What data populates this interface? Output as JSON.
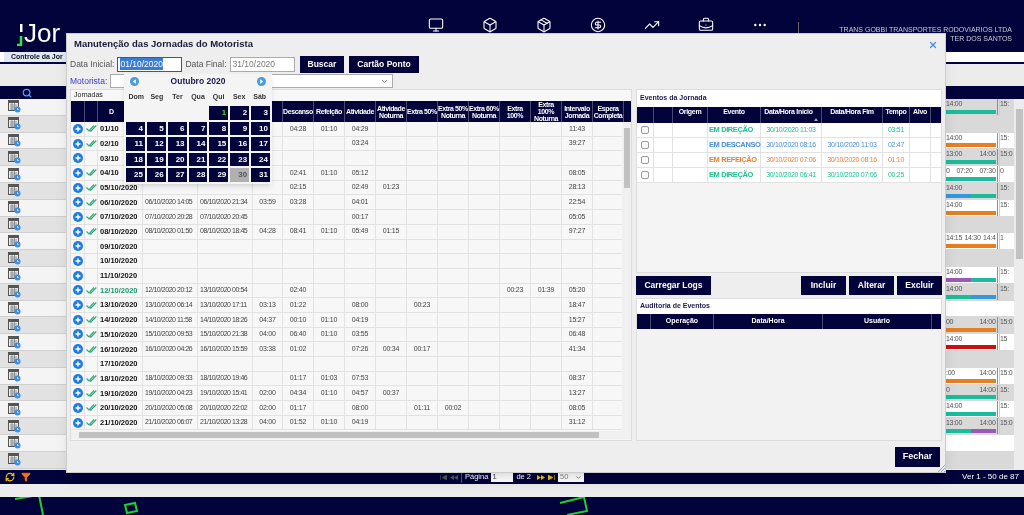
{
  "header": {
    "logo": "Jor",
    "company": "TRANS GOBBI TRANSPORTES RODOVIARIOS LTDA",
    "user": "TER DOS SANTOS"
  },
  "page_tab": "Controle da Jor",
  "grid": {
    "rows": [
      {
        "shaded": true,
        "labels": [
          "14:00",
          "15:"
        ],
        "segments": [
          {
            "color": "#1abc9c"
          }
        ]
      },
      {
        "shaded": true
      },
      {
        "shaded": false,
        "labels": [
          "14:00",
          "15:"
        ],
        "segments": [
          {
            "color": "#e67e22"
          }
        ]
      },
      {
        "shaded": true,
        "labels": [
          "13:00",
          "14:00",
          "15:0"
        ],
        "segments": [
          {
            "color": "#1abc9c"
          }
        ]
      },
      {
        "shaded": false,
        "labels": [
          "0",
          "07:20",
          "07:30",
          "0"
        ],
        "segments": [
          {
            "color": "#1abc9c"
          }
        ]
      },
      {
        "shaded": true,
        "labels": [
          "14:00",
          "15:"
        ],
        "segments": [
          {
            "color": "#3498db"
          },
          {
            "color": "#1abc9c"
          }
        ]
      },
      {
        "shaded": false,
        "labels": [
          "14:00",
          "15:"
        ],
        "segments": [
          {
            "color": "#e67e22"
          }
        ]
      },
      {
        "shaded": true
      },
      {
        "shaded": false,
        "labels": [
          "14:15",
          "14:30",
          "14:4",
          "1"
        ],
        "segments": [
          {
            "color": "#e67e22"
          }
        ]
      },
      {
        "shaded": true
      },
      {
        "shaded": false,
        "labels": [
          "14:00",
          "15:"
        ],
        "segments": [
          {
            "color": "#9b59b6"
          },
          {
            "color": "#1abc9c"
          }
        ]
      },
      {
        "shaded": true,
        "labels": [
          "14:00",
          "15:"
        ],
        "segments": [
          {
            "color": "#1abc9c"
          },
          {
            "color": "#3498db"
          }
        ]
      },
      {
        "shaded": false
      },
      {
        "shaded": true,
        "labels": [
          "00",
          "14:00",
          "15:0"
        ],
        "segments": [
          {
            "color": "#e67e22"
          }
        ]
      },
      {
        "shaded": false,
        "labels": [
          "14:00",
          "15"
        ],
        "segments": [
          {
            "color": "#cc1010"
          }
        ]
      },
      {
        "shaded": true
      },
      {
        "shaded": false,
        "labels": [
          ":00",
          "14:00",
          "15:0"
        ],
        "segments": [
          {
            "color": "#e67e22"
          }
        ]
      },
      {
        "shaded": true,
        "labels": [
          "0",
          "14:00",
          "15:"
        ],
        "segments": [
          {
            "color": "#1abc9c"
          }
        ]
      },
      {
        "shaded": false,
        "labels": [
          "14:00",
          "15:"
        ],
        "segments": [
          {
            "color": "#1abc9c"
          }
        ]
      },
      {
        "shaded": true,
        "labels": [
          "13:00",
          "14:00",
          "15:0"
        ],
        "segments": [
          {
            "color": "#1abc9c"
          },
          {
            "color": "#9b59b6"
          }
        ]
      },
      {
        "shaded": false
      },
      {
        "shaded": true
      }
    ]
  },
  "pager": {
    "page_label": "Página",
    "page": "1",
    "page_total": "de 2",
    "page_size": "50",
    "summary": "Ver 1 - 50 de 87"
  },
  "modal": {
    "title": "Manutenção das Jornadas do Motorista",
    "filters": {
      "start_label": "Data Inicial:",
      "start_value": "01/10/2020",
      "end_label": "Data Final:",
      "end_value": "31/10/2020",
      "driver_label": "Motorista:"
    },
    "buttons": [
      "Buscar",
      "Cartão Ponto"
    ],
    "calendar": {
      "month": "Outubro 2020",
      "weekdays": [
        "Dom",
        "Seg",
        "Ter",
        "Qua",
        "Qui",
        "Sex",
        "Sáb"
      ],
      "weeks": [
        [
          {
            "kind": "blank"
          },
          {
            "kind": "blank"
          },
          {
            "kind": "blank"
          },
          {
            "kind": "blank"
          },
          {
            "kind": "day",
            "label": "1",
            "selected": true,
            "today": false
          },
          {
            "kind": "day",
            "label": "2",
            "selected": false,
            "today": false
          },
          {
            "kind": "day",
            "label": "3",
            "selected": false,
            "today": false
          }
        ],
        [
          {
            "kind": "day",
            "label": "4",
            "selected": false,
            "today": false
          },
          {
            "kind": "day",
            "label": "5",
            "selected": false,
            "today": false
          },
          {
            "kind": "day",
            "label": "6",
            "selected": false,
            "today": false
          },
          {
            "kind": "day",
            "label": "7",
            "selected": false,
            "today": false
          },
          {
            "kind": "day",
            "label": "8",
            "selected": false,
            "today": false
          },
          {
            "kind": "day",
            "label": "9",
            "selected": false,
            "today": false
          },
          {
            "kind": "day",
            "label": "10",
            "selected": false,
            "today": false
          }
        ],
        [
          {
            "kind": "day",
            "label": "11",
            "selected": false,
            "today": false
          },
          {
            "kind": "day",
            "label": "12",
            "selected": false,
            "today": false
          },
          {
            "kind": "day",
            "label": "13",
            "selected": false,
            "today": false
          },
          {
            "kind": "day",
            "label": "14",
            "selected": false,
            "today": false
          },
          {
            "kind": "day",
            "label": "15",
            "selected": false,
            "today": false
          },
          {
            "kind": "day",
            "label": "16",
            "selected": false,
            "today": false
          },
          {
            "kind": "day",
            "label": "17",
            "selected": false,
            "today": false
          }
        ],
        [
          {
            "kind": "day",
            "label": "18",
            "selected": false,
            "today": false
          },
          {
            "kind": "day",
            "label": "19",
            "selected": false,
            "today": false
          },
          {
            "kind": "day",
            "label": "20",
            "selected": false,
            "today": false
          },
          {
            "kind": "day",
            "label": "21",
            "selected": false,
            "today": false
          },
          {
            "kind": "day",
            "label": "22",
            "selected": false,
            "today": false
          },
          {
            "kind": "day",
            "label": "23",
            "selected": false,
            "today": false
          },
          {
            "kind": "day",
            "label": "24",
            "selected": false,
            "today": false
          }
        ],
        [
          {
            "kind": "day",
            "label": "25",
            "selected": false,
            "today": false
          },
          {
            "kind": "day",
            "label": "26",
            "selected": false,
            "today": false
          },
          {
            "kind": "day",
            "label": "27",
            "selected": false,
            "today": false
          },
          {
            "kind": "day",
            "label": "28",
            "selected": false,
            "today": false
          },
          {
            "kind": "day",
            "label": "29",
            "selected": false,
            "today": false
          },
          {
            "kind": "day",
            "label": "30",
            "selected": false,
            "today": true
          },
          {
            "kind": "day",
            "label": "31",
            "selected": false,
            "today": false
          }
        ]
      ]
    },
    "jornadas": {
      "caption": "Jornadas",
      "columns": [
        {
          "kind": "date",
          "label": "D"
        },
        {
          "kind": "datetime"
        },
        {
          "kind": "datetime"
        },
        {
          "kind": "duration"
        },
        {
          "kind": "duration",
          "label": "Descanso"
        },
        {
          "kind": "duration",
          "label": "Refeição"
        },
        {
          "kind": "duration",
          "label": "Atividade"
        },
        {
          "kind": "duration",
          "label": "Atividade Noturna"
        },
        {
          "kind": "duration",
          "label": "Extra 50%"
        },
        {
          "kind": "duration",
          "label": "Extra 50% Noturna"
        },
        {
          "kind": "duration",
          "label": "Extra 60% Noturna"
        },
        {
          "kind": "duration",
          "label": "Extra 100%"
        },
        {
          "kind": "duration",
          "label": "Extra 100% Noturna"
        },
        {
          "kind": "duration",
          "label": "Intervalo Jornada"
        },
        {
          "kind": "duration",
          "label": "Espera Completa"
        }
      ],
      "rows": [
        {
          "validated": true,
          "highlighted": false,
          "cells": [
            "01/10",
            null,
            null,
            null,
            "04:28",
            "01:10",
            "04:29",
            null,
            null,
            null,
            null,
            null,
            null,
            "11:43",
            null
          ]
        },
        {
          "validated": true,
          "highlighted": false,
          "cells": [
            "02/10",
            null,
            null,
            null,
            null,
            null,
            "03:24",
            null,
            null,
            null,
            null,
            null,
            null,
            "39:27",
            null
          ]
        },
        {
          "validated": false,
          "highlighted": false,
          "cells": [
            "03/10",
            null,
            null,
            null,
            null,
            null,
            null,
            null,
            null,
            null,
            null,
            null,
            null,
            null,
            null
          ]
        },
        {
          "validated": true,
          "highlighted": false,
          "cells": [
            "04/10",
            null,
            null,
            null,
            "02:41",
            "01:10",
            "05:12",
            null,
            null,
            null,
            null,
            null,
            null,
            "08:05",
            null
          ]
        },
        {
          "validated": true,
          "highlighted": false,
          "cells": [
            "05/10/2020",
            null,
            null,
            null,
            "02:15",
            null,
            "02:49",
            "01:23",
            null,
            null,
            null,
            null,
            null,
            "28:13",
            null
          ]
        },
        {
          "validated": true,
          "highlighted": false,
          "cells": [
            "06/10/2020",
            "06/10/2020 14:05",
            "06/10/2020 21:34",
            "03:59",
            "03:28",
            null,
            "04:01",
            null,
            null,
            null,
            null,
            null,
            null,
            "22:54",
            null
          ]
        },
        {
          "validated": true,
          "highlighted": false,
          "cells": [
            "07/10/2020",
            "07/10/2020 20:28",
            "07/10/2020 20:45",
            null,
            null,
            null,
            "00:17",
            null,
            null,
            null,
            null,
            null,
            null,
            "05:05",
            null
          ]
        },
        {
          "validated": true,
          "highlighted": false,
          "cells": [
            "08/10/2020",
            "08/10/2020 01:50",
            "08/10/2020 18:45",
            "04:28",
            "08:41",
            "01:10",
            "05:49",
            "01:15",
            null,
            null,
            null,
            null,
            null,
            "97:27",
            null
          ]
        },
        {
          "validated": false,
          "highlighted": false,
          "cells": [
            "09/10/2020",
            null,
            null,
            null,
            null,
            null,
            null,
            null,
            null,
            null,
            null,
            null,
            null,
            null,
            null
          ]
        },
        {
          "validated": false,
          "highlighted": false,
          "cells": [
            "10/10/2020",
            null,
            null,
            null,
            null,
            null,
            null,
            null,
            null,
            null,
            null,
            null,
            null,
            null,
            null
          ]
        },
        {
          "validated": false,
          "highlighted": false,
          "cells": [
            "11/10/2020",
            null,
            null,
            null,
            null,
            null,
            null,
            null,
            null,
            null,
            null,
            null,
            null,
            null,
            null
          ]
        },
        {
          "validated": true,
          "highlighted": true,
          "cells": [
            "12/10/2020",
            "12/10/2020 20:12",
            "13/10/2020 00:54",
            null,
            "02:40",
            null,
            null,
            null,
            null,
            null,
            null,
            "00:23",
            "01:39",
            "05:20",
            null
          ]
        },
        {
          "validated": true,
          "highlighted": false,
          "cells": [
            "13/10/2020",
            "13/10/2020 06:14",
            "13/10/2020 17:11",
            "03:13",
            "01:22",
            null,
            "08:00",
            null,
            "00:23",
            null,
            null,
            null,
            null,
            "18:47",
            null
          ]
        },
        {
          "validated": true,
          "highlighted": false,
          "cells": [
            "14/10/2020",
            "14/10/2020 11:58",
            "14/10/2020 18:26",
            "04:37",
            "00:10",
            "01:10",
            "04:19",
            null,
            null,
            null,
            null,
            null,
            null,
            "15:27",
            null
          ]
        },
        {
          "validated": true,
          "highlighted": false,
          "cells": [
            "15/10/2020",
            "15/10/2020 09:53",
            "15/10/2020 21:38",
            "04:00",
            "06:40",
            "01:10",
            "03:55",
            null,
            null,
            null,
            null,
            null,
            null,
            "06:48",
            null
          ]
        },
        {
          "validated": true,
          "highlighted": false,
          "cells": [
            "16/10/2020",
            "16/10/2020 04:26",
            "16/10/2020 15:59",
            "03:38",
            "01:02",
            null,
            "07:26",
            "00:34",
            "00:17",
            null,
            null,
            null,
            null,
            "41:34",
            null
          ]
        },
        {
          "validated": false,
          "highlighted": false,
          "cells": [
            "17/10/2020",
            null,
            null,
            null,
            null,
            null,
            null,
            null,
            null,
            null,
            null,
            null,
            null,
            null,
            null
          ]
        },
        {
          "validated": true,
          "highlighted": false,
          "cells": [
            "18/10/2020",
            "18/10/2020 09:33",
            "18/10/2020 19:46",
            null,
            "01:17",
            "01:03",
            "07:53",
            null,
            null,
            null,
            null,
            null,
            null,
            "08:37",
            null
          ]
        },
        {
          "validated": true,
          "highlighted": false,
          "cells": [
            "19/10/2020",
            "19/10/2020 04:23",
            "19/10/2020 15:41",
            "02:00",
            "04:34",
            "01:10",
            "04:57",
            "00:37",
            null,
            null,
            null,
            null,
            null,
            "13:27",
            null
          ]
        },
        {
          "validated": true,
          "highlighted": false,
          "cells": [
            "20/10/2020",
            "20/10/2020 05:08",
            "20/10/2020 22:02",
            "02:00",
            "01:17",
            null,
            "08:00",
            null,
            "01:11",
            "00:02",
            null,
            null,
            null,
            "08:05",
            null
          ]
        },
        {
          "validated": true,
          "highlighted": false,
          "cells": [
            "21/10/2020",
            "21/10/2020 06:07",
            "21/10/2020 13:28",
            "04:00",
            "01:52",
            "01:10",
            "04:19",
            null,
            null,
            null,
            null,
            null,
            null,
            "31:12",
            null
          ]
        }
      ]
    },
    "events": {
      "caption": "Eventos da Jornada",
      "columns": [
        {
          "label": "Origem",
          "sorted": false
        },
        {
          "label": "Evento",
          "sorted": false
        },
        {
          "label": "Data/Hora Início",
          "sorted": true
        },
        {
          "label": "Data/Hora Fim",
          "sorted": false
        },
        {
          "label": "Tempo",
          "sorted": false
        },
        {
          "label": "Alvo",
          "sorted": false
        }
      ],
      "rows": [
        {
          "checked": false,
          "color": "#1fbf8f",
          "event": "EM DIREÇÃO",
          "start": "30/10/2020 11:03",
          "duration": "03:51"
        },
        {
          "checked": false,
          "color": "#4a90d9",
          "event": "EM DESCANSO",
          "start": "30/10/2020 08:16",
          "end": "30/10/2020 11:03",
          "duration": "02:47"
        },
        {
          "checked": false,
          "color": "#e8833a",
          "event": "EM REFEIÇÃO",
          "start": "30/10/2020 07:06",
          "end": "30/10/2020 08:16",
          "duration": "01:10"
        },
        {
          "checked": false,
          "color": "#1fbf8f",
          "event": "EM DIREÇÃO",
          "start": "30/10/2020 06:41",
          "end": "30/10/2020 07:06",
          "duration": "00:25"
        }
      ]
    },
    "load_button": "Carregar Logs",
    "actions": [
      "Incluir",
      "Alterar",
      "Excluir"
    ],
    "audit": {
      "caption": "Auditoria de Eventos",
      "columns": [
        "Operação",
        "Data/Hora",
        "Usuário"
      ]
    },
    "close_button": "Fechar"
  }
}
